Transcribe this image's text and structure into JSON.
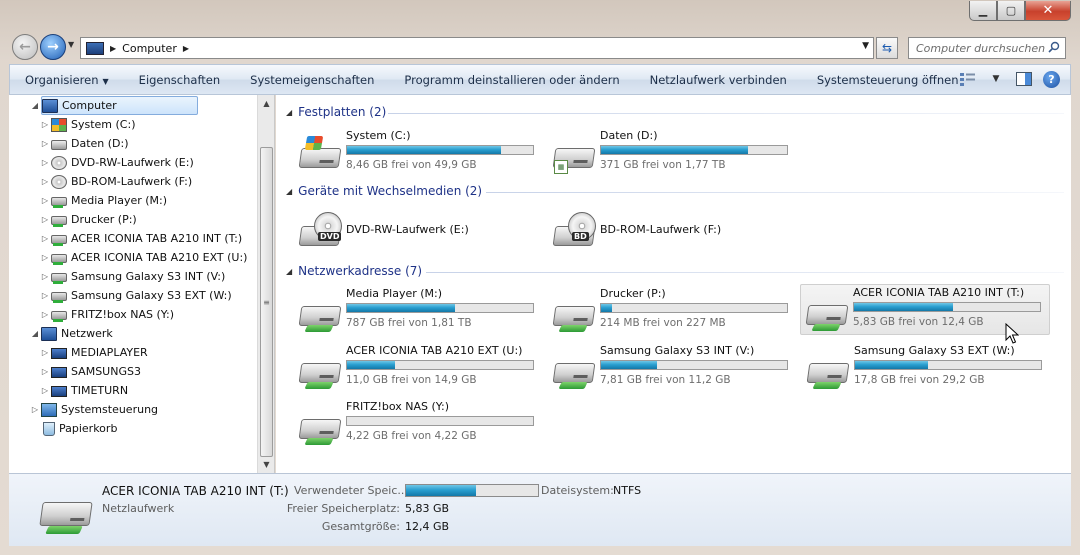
{
  "window": {
    "caption_buttons": {
      "minimize": "▁",
      "maximize": "▢",
      "close": "✕"
    }
  },
  "address": {
    "path": [
      "Computer"
    ],
    "search_placeholder": "Computer durchsuchen"
  },
  "toolbar": {
    "items": [
      {
        "label": "Organisieren",
        "has_dropdown": true
      },
      {
        "label": "Eigenschaften"
      },
      {
        "label": "Systemeigenschaften"
      },
      {
        "label": "Programm deinstallieren oder ändern"
      },
      {
        "label": "Netzlaufwerk verbinden"
      },
      {
        "label": "Systemsteuerung öffnen"
      }
    ]
  },
  "nav": {
    "items": [
      {
        "label": "Computer",
        "icon": "computer-icon",
        "level": 0,
        "expanded": true,
        "selected": true
      },
      {
        "label": "System (C:)",
        "icon": "windows-drive-icon",
        "level": 1
      },
      {
        "label": "Daten (D:)",
        "icon": "drive-icon",
        "level": 1
      },
      {
        "label": "DVD-RW-Laufwerk (E:)",
        "icon": "dvd-drive-icon",
        "level": 1
      },
      {
        "label": "BD-ROM-Laufwerk (F:)",
        "icon": "bd-drive-icon",
        "level": 1
      },
      {
        "label": "Media Player (M:)",
        "icon": "network-drive-icon",
        "level": 1
      },
      {
        "label": "Drucker (P:)",
        "icon": "network-drive-icon",
        "level": 1
      },
      {
        "label": "ACER ICONIA TAB A210 INT (T:)",
        "icon": "network-drive-icon",
        "level": 1
      },
      {
        "label": "ACER ICONIA TAB A210 EXT (U:)",
        "icon": "network-drive-icon",
        "level": 1
      },
      {
        "label": "Samsung Galaxy S3 INT (V:)",
        "icon": "network-drive-icon",
        "level": 1
      },
      {
        "label": "Samsung Galaxy S3 EXT (W:)",
        "icon": "network-drive-icon",
        "level": 1
      },
      {
        "label": "FRITZ!box NAS (Y:)",
        "icon": "network-drive-icon",
        "level": 1
      },
      {
        "label": "Netzwerk",
        "icon": "network-icon",
        "level": 0,
        "expanded": true
      },
      {
        "label": "MEDIAPLAYER",
        "icon": "pc-icon",
        "level": 1
      },
      {
        "label": "SAMSUNGS3",
        "icon": "pc-icon",
        "level": 1
      },
      {
        "label": "TIMETURN",
        "icon": "pc-icon",
        "level": 1
      },
      {
        "label": "Systemsteuerung",
        "icon": "control-panel-icon",
        "level": 0
      },
      {
        "label": "Papierkorb",
        "icon": "recycle-bin-icon",
        "level": 0,
        "no_arrow": true
      }
    ]
  },
  "groups": [
    {
      "title": "Festplatten (2)"
    },
    {
      "title": "Geräte mit Wechselmedien (2)"
    },
    {
      "title": "Netzwerkadresse (7)"
    }
  ],
  "drives": {
    "c": {
      "name": "System (C:)",
      "free": "8,46 GB frei von 49,9 GB",
      "used_fraction": 0.83
    },
    "d": {
      "name": "Daten (D:)",
      "free": "371 GB frei von 1,77 TB",
      "used_fraction": 0.79
    },
    "e": {
      "name": "DVD-RW-Laufwerk (E:)",
      "disc": "DVD"
    },
    "f": {
      "name": "BD-ROM-Laufwerk (F:)",
      "disc": "BD"
    },
    "m": {
      "name": "Media Player (M:)",
      "free": "787 GB frei von 1,81 TB",
      "used_fraction": 0.58
    },
    "p": {
      "name": "Drucker (P:)",
      "free": "214 MB frei von 227 MB",
      "used_fraction": 0.06
    },
    "t": {
      "name": "ACER ICONIA TAB A210 INT (T:)",
      "free": "5,83 GB frei von 12,4 GB",
      "used_fraction": 0.53
    },
    "u": {
      "name": "ACER ICONIA TAB A210 EXT (U:)",
      "free": "11,0 GB frei von 14,9 GB",
      "used_fraction": 0.26
    },
    "v": {
      "name": "Samsung Galaxy S3 INT (V:)",
      "free": "7,81 GB frei von 11,2 GB",
      "used_fraction": 0.3
    },
    "w": {
      "name": "Samsung Galaxy S3 EXT (W:)",
      "free": "17,8 GB frei von 29,2 GB",
      "used_fraction": 0.39
    },
    "y": {
      "name": "FRITZ!box NAS (Y:)",
      "free": "4,22 GB frei von 4,22 GB",
      "used_fraction": 0.0
    }
  },
  "details": {
    "name": "ACER ICONIA TAB A210 INT (T:)",
    "type": "Netzlaufwerk",
    "used_label": "Verwendeter Speic...",
    "used_fraction": 0.53,
    "free_label": "Freier Speicherplatz:",
    "free_value": "5,83 GB",
    "total_label": "Gesamtgröße:",
    "total_value": "12,4 GB",
    "fs_label": "Dateisystem:",
    "fs_value": "NTFS"
  }
}
